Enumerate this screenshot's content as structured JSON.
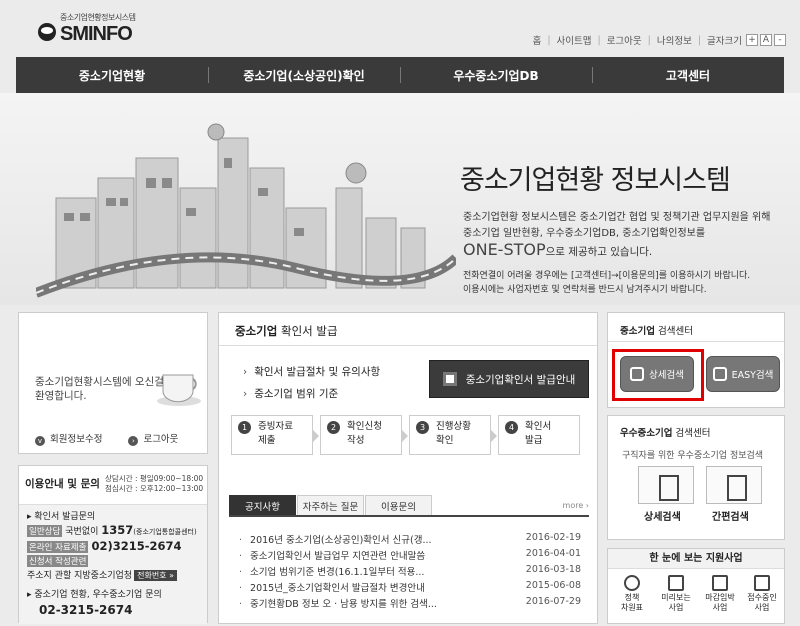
{
  "header": {
    "logo_sub": "중소기업현황정보시스템",
    "logo_name": "SMINFO",
    "util": [
      "홈",
      "사이트맵",
      "로그아웃",
      "나의정보"
    ],
    "font_size_label": "글자크기",
    "font_plus": "+",
    "font_a": "A",
    "font_minus": "-"
  },
  "nav": [
    "중소기업현황",
    "중소기업(소상공인)확인",
    "우수중소기업DB",
    "고객센터"
  ],
  "hero": {
    "title": "중소기업현황 정보시스템",
    "desc1": "중소기업현황 정보시스템은 중소기업간 협업 및 정책기관 업무지원을 위해",
    "desc2": "중소기업 일반현황, 우수중소기업DB, 중소기업확인정보를",
    "desc3_big": "ONE-STOP",
    "desc3_rest": "으로 제공하고 있습니다.",
    "note1": "전화연결이 어려울 경우에는 [고객센터]→[이용문의]를 이용하시기 바랍니다.",
    "note2": "이용시에는 사업자번호 및 연락처를 반드시 남겨주시기 바랍니다."
  },
  "welcome": {
    "message": "중소기업현황시스템에 오신걸 환영합니다.",
    "link1": "회원정보수정",
    "link2": "로그아웃"
  },
  "contact": {
    "title": "이용안내 및 문의",
    "hours1": "상담시간 : 평일09:00~18:00",
    "hours2": "점심시간 : 오후12:00~13:00",
    "line1": "확인서 발급문의",
    "tag1": "일반상담",
    "line2_pre": "국번없이",
    "line2_num": "1357",
    "line2_post": "(중소기업통합콜센터)",
    "tag2": "온라인 자료제출",
    "line3_num": "02)3215-2674",
    "tag3": "신청서 작성관련",
    "line4": "주소지 관할 지방중소기업청",
    "phone_btn": "전화번호 »",
    "line5": "중소기업 현황, 우수중소기업 문의",
    "line6_num": "02-3215-2674"
  },
  "center": {
    "heading_bold": "중소기업",
    "heading_rest": "확인서 발급",
    "bullet1": "확인서 발급절차 및 유의사항",
    "bullet2": "중소기업 범위 기준",
    "issue_button": "중소기업확인서 발급안내",
    "steps": [
      {
        "num": "1",
        "line1": "증빙자료",
        "line2": "제출"
      },
      {
        "num": "2",
        "line1": "확인신청",
        "line2": "작성"
      },
      {
        "num": "3",
        "line1": "진행상황",
        "line2": "확인"
      },
      {
        "num": "4",
        "line1": "확인서",
        "line2": "발급"
      }
    ],
    "tabs": [
      "공지사항",
      "자주하는 질문",
      "이용문의"
    ],
    "more": "more ›",
    "notices": [
      {
        "title": "2016년 중소기업(소상공인)확인서 신규(갱...",
        "date": "2016-02-19"
      },
      {
        "title": "중소기업확인서 발급업무 지연관련 안내말씀",
        "date": "2016-04-01"
      },
      {
        "title": "소기업 범위기준 변경(16.1.1일부터 적용...",
        "date": "2016-03-18"
      },
      {
        "title": "2015년_중소기업확인서 발급절차 변경안내",
        "date": "2015-06-08"
      },
      {
        "title": "중기현황DB 정보 오 · 남용 방지를 위한 검색...",
        "date": "2016-07-29"
      }
    ]
  },
  "search": {
    "heading_bold": "중소기업",
    "heading_rest": "검색센터",
    "btn_detail": "상세검색",
    "btn_easy": "EASY검색"
  },
  "excellent": {
    "heading_bold": "우수중소기업",
    "heading_rest": "검색센터",
    "sub": "구직자를 위한 우수중소기업 정보검색",
    "label1": "상세검색",
    "label2": "간편검색"
  },
  "support": {
    "title": "한 눈에 보는 지원사업",
    "items": [
      {
        "l1": "정책",
        "l2": "차원표"
      },
      {
        "l1": "미리보는",
        "l2": "사업"
      },
      {
        "l1": "마감임박",
        "l2": "사업"
      },
      {
        "l1": "접수중인",
        "l2": "사업"
      }
    ]
  }
}
